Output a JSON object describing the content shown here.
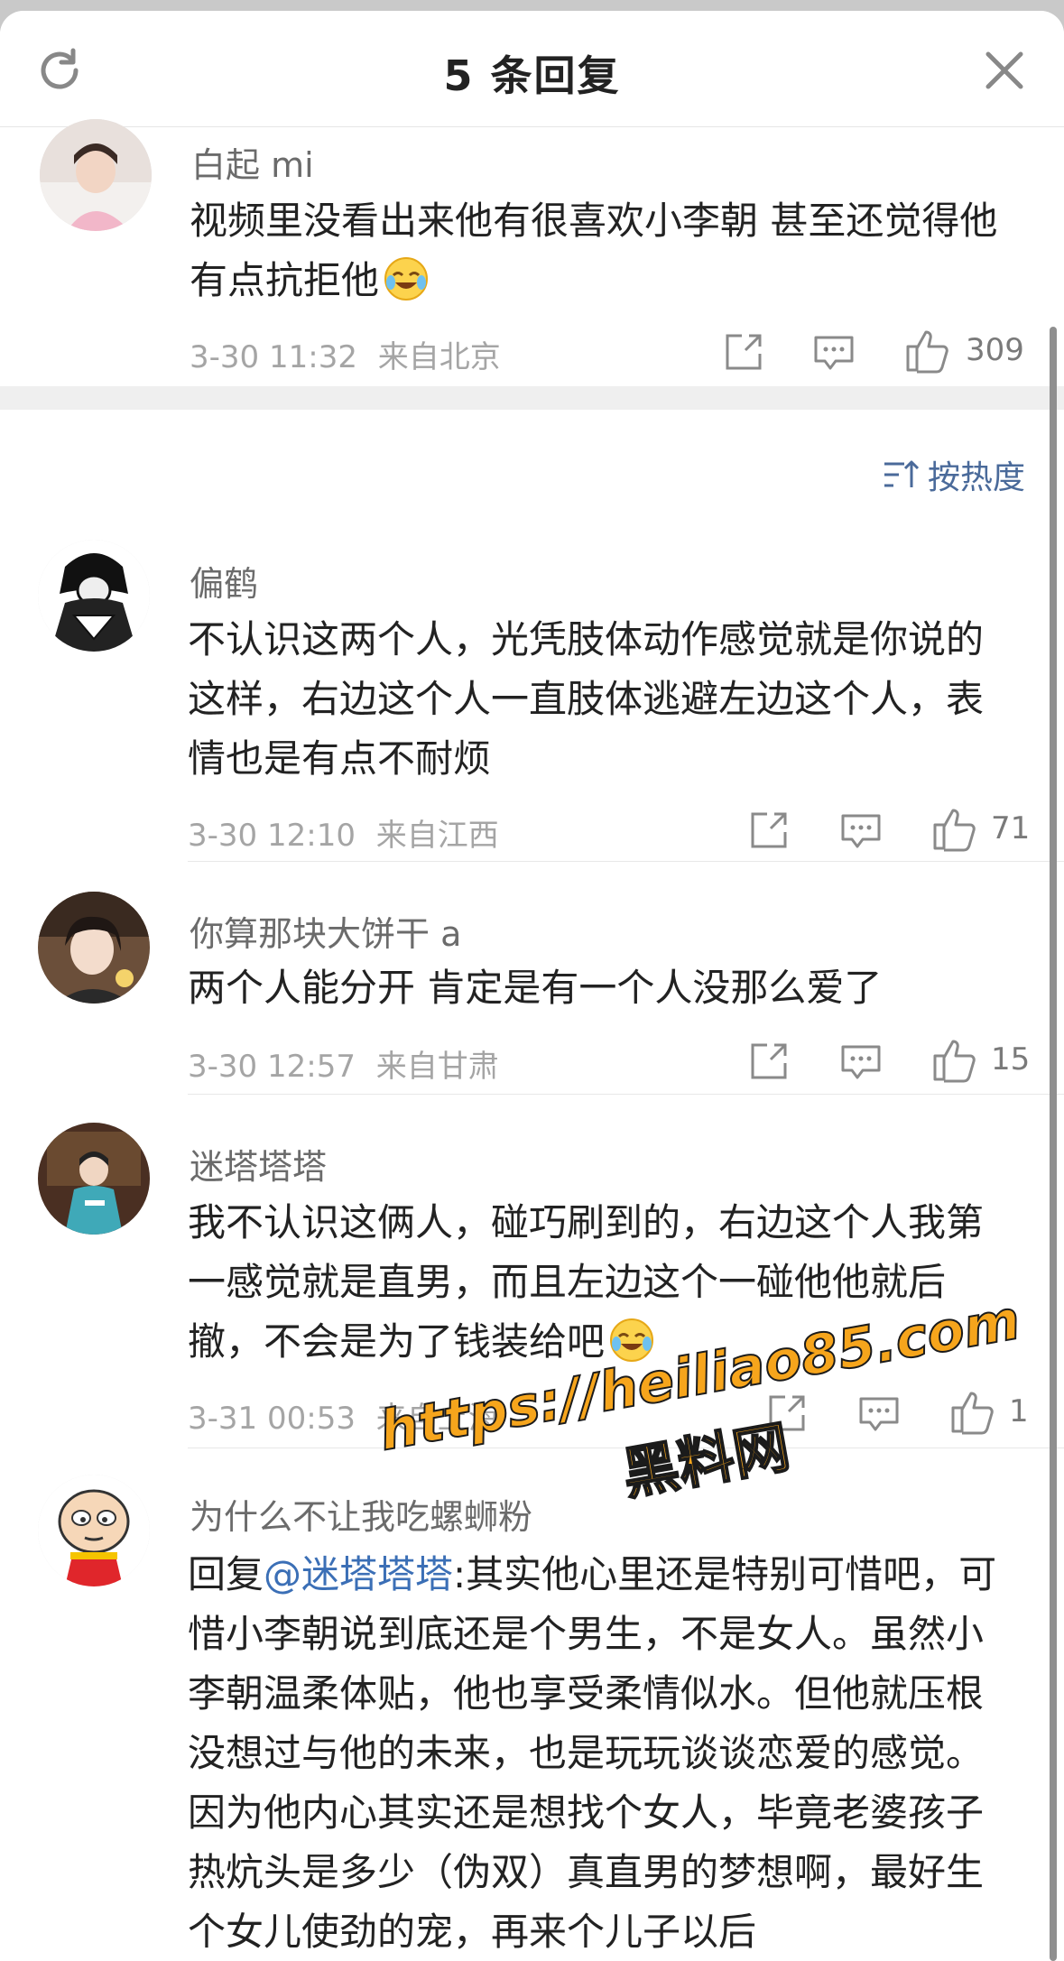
{
  "header": {
    "title": "5 条回复"
  },
  "root_comment": {
    "username": "白起 mi",
    "content": "视频里没看出来他有很喜欢小李朝 甚至还觉得他有点抗拒他",
    "emoji": "laughing-crying-emoji",
    "time": "3-30 11:32",
    "location": "来自北京",
    "likes": "309"
  },
  "sort": {
    "label": "按热度"
  },
  "replies": [
    {
      "username": "偏鹤",
      "content": "不认识这两个人，光凭肢体动作感觉就是你说的这样，右边这个人一直肢体逃避左边这个人，表情也是有点不耐烦",
      "time": "3-30 12:10",
      "location": "来自江西",
      "likes": "71"
    },
    {
      "username": "你算那块大饼干 a",
      "content": "两个人能分开 肯定是有一个人没那么爱了",
      "time": "3-30 12:57",
      "location": "来自甘肃",
      "likes": "15"
    },
    {
      "username": "迷塔塔塔",
      "content": "我不认识这俩人，碰巧刷到的，右边这个人我第一感觉就是直男，而且左边这个一碰他他就后撤，不会是为了钱装给吧",
      "emoji": "laughing-crying-emoji",
      "time": "3-31 00:53",
      "location": "来自上海",
      "likes": "1"
    },
    {
      "username": "为什么不让我吃螺蛳粉",
      "reply_prefix": "回复",
      "mention": "@迷塔塔塔",
      "content": ":其实他心里还是特别可惜吧，可惜小李朝说到底还是个男生，不是女人。虽然小李朝温柔体贴，他也享受柔情似水。但他就压根没想过与他的未来，也是玩玩谈谈恋爱的感觉。因为他内心其实还是想找个女人，毕竟老婆孩子热炕头是多少（伪双）真直男的梦想啊，最好生个女儿使劲的宠，再来个儿子以后"
    }
  ],
  "watermark": {
    "url": "https://heiliao85.com",
    "name": "黑料网"
  },
  "colors": {
    "link": "#3b6fb6",
    "meta": "#a5a5a5",
    "text": "#222222",
    "watermark": "#f6a51c"
  },
  "icons": [
    "refresh-icon",
    "close-icon",
    "share-icon",
    "comment-icon",
    "like-icon",
    "sort-icon"
  ]
}
